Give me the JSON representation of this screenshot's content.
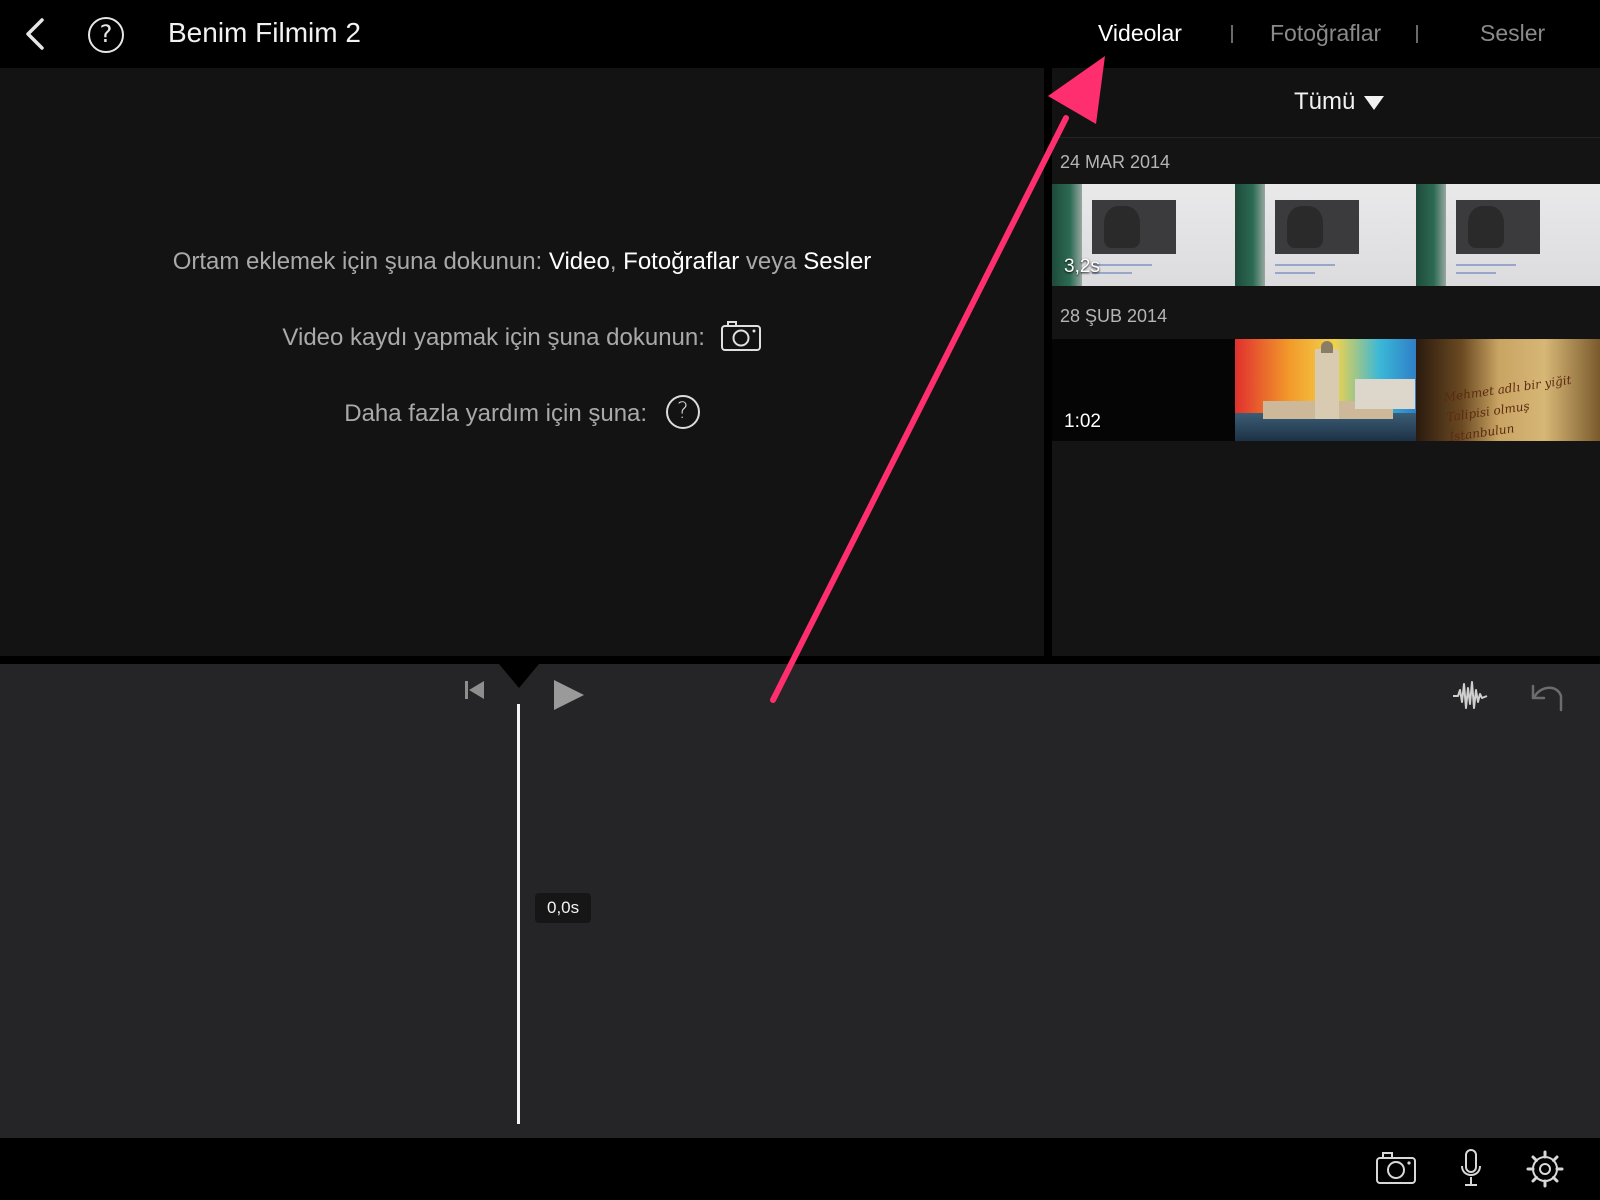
{
  "header": {
    "back_icon": "chevron-left-icon",
    "help_label": "?",
    "project_title": "Benim Filmim 2",
    "tabs": [
      {
        "label": "Videolar",
        "active": true
      },
      {
        "label": "Fotoğraflar",
        "active": false
      },
      {
        "label": "Sesler",
        "active": false
      }
    ]
  },
  "viewer": {
    "hint1_prefix": "Ortam eklemek için şuna dokunun: ",
    "hint1_video": "Video",
    "hint1_comma": ", ",
    "hint1_photos": "Fotoğraflar",
    "hint1_or": " veya ",
    "hint1_audio": "Sesler",
    "hint2": "Video kaydı yapmak için şuna dokunun:",
    "hint3": "Daha fazla yardım için şuna:",
    "help_label": "?"
  },
  "browser": {
    "filter_label": "Tümü",
    "groups": [
      {
        "date": "24 MAR 2014",
        "first_clip_duration": "3,2s"
      },
      {
        "date": "28 ŞUB 2014",
        "first_clip_duration": "1:02"
      }
    ],
    "scroll_text_line1": "Mehmet adlı bir yiğit",
    "scroll_text_line2": "Talipisi olmuş İstanbulun"
  },
  "timeline": {
    "time": "0,0s"
  },
  "colors": {
    "accent_arrow": "#ff2e6e",
    "active_tab": "#ffffff",
    "inactive_tab": "#8a8a8a",
    "timeline_bg": "#252527",
    "viewer_bg": "#131313"
  },
  "icons": {
    "skip_back": "skip-to-start-icon",
    "play": "play-icon",
    "waveform": "audio-waveform-icon",
    "undo": "undo-icon",
    "camera": "camera-icon",
    "microphone": "microphone-icon",
    "settings": "gear-icon"
  }
}
